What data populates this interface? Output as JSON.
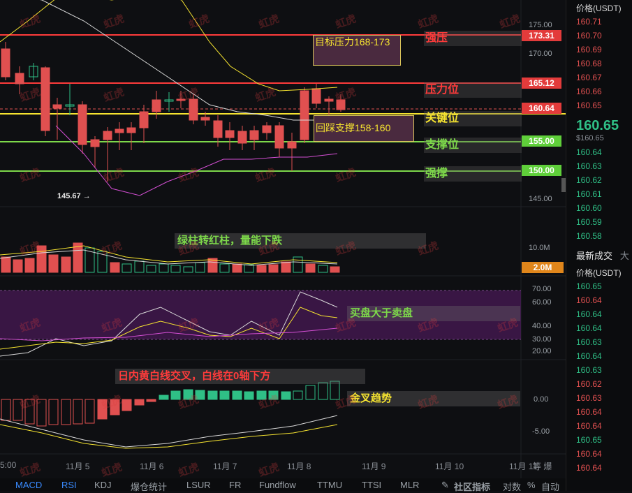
{
  "watermark": "虹虎",
  "price_axis": [
    "175.00",
    "170.00",
    "165.00",
    "160.00",
    "155.00",
    "150.00",
    "145.00"
  ],
  "volume_axis": [
    "10.0M"
  ],
  "rsi_axis": [
    "70.00",
    "60.00",
    "50.00",
    "40.00",
    "30.00",
    "20.00"
  ],
  "macd_axis": [
    "0.00",
    "-5.00"
  ],
  "dates": [
    "5:00",
    "11月 5",
    "11月 6",
    "11月 7",
    "11月 8",
    "11月 9",
    "11月 10",
    "11月 11"
  ],
  "date_suffix": "等  爆",
  "price_tags": {
    "strong_resist": "173.31",
    "resist": "165.12",
    "current": "160.64",
    "support": "155.00",
    "strong_support": "150.00",
    "volume": "2.0M"
  },
  "levels": {
    "strong_resist": "强压",
    "resist": "压力位",
    "key": "关键位",
    "support": "支撑位",
    "strong_support": "强撑"
  },
  "notes": {
    "target": "目标压力168-173",
    "pullback": "回踩支撑158-160",
    "low_marker": "145.67",
    "volume_note": "绿柱转红柱，量能下跌",
    "rsi_note": "买盘大于卖盘",
    "macd_note": "日内黄白线交叉，白线在0轴下方",
    "macd_note2": "金叉趋势"
  },
  "right_panel": {
    "header1": "价格(USDT)",
    "asks": [
      "160.71",
      "160.70",
      "160.69",
      "160.68",
      "160.67",
      "160.66",
      "160.65"
    ],
    "last_price": "160.65",
    "last_price_usd": "$160.65",
    "bids": [
      "160.64",
      "160.63",
      "160.62",
      "160.61",
      "160.60",
      "160.59",
      "160.58"
    ],
    "trades_title": "最新成交",
    "trades_title_extra": "大",
    "header2": "价格(USDT)",
    "trades": [
      {
        "p": "160.65",
        "side": "up"
      },
      {
        "p": "160.64",
        "side": "down"
      },
      {
        "p": "160.64",
        "side": "up"
      },
      {
        "p": "160.64",
        "side": "up"
      },
      {
        "p": "160.63",
        "side": "up"
      },
      {
        "p": "160.64",
        "side": "up"
      },
      {
        "p": "160.63",
        "side": "up"
      },
      {
        "p": "160.62",
        "side": "down"
      },
      {
        "p": "160.63",
        "side": "down"
      },
      {
        "p": "160.64",
        "side": "down"
      },
      {
        "p": "160.64",
        "side": "down"
      },
      {
        "p": "160.65",
        "side": "up"
      },
      {
        "p": "160.64",
        "side": "down"
      },
      {
        "p": "160.64",
        "side": "down"
      }
    ]
  },
  "tabs": [
    "MACD",
    "RSI",
    "KDJ",
    "爆仓统计",
    "LSUR",
    "FR",
    "Fundflow",
    "TTMU",
    "TTSI",
    "MLR"
  ],
  "toolbar_right": [
    "社区指标",
    "对数",
    "%",
    "自动"
  ],
  "colors": {
    "up": "#2fbf86",
    "down": "#e05050",
    "red_line": "#ff3b3b",
    "green_line": "#7dd84a",
    "yellow_line": "#f5e330",
    "tab_active": "#3a8bff"
  }
}
